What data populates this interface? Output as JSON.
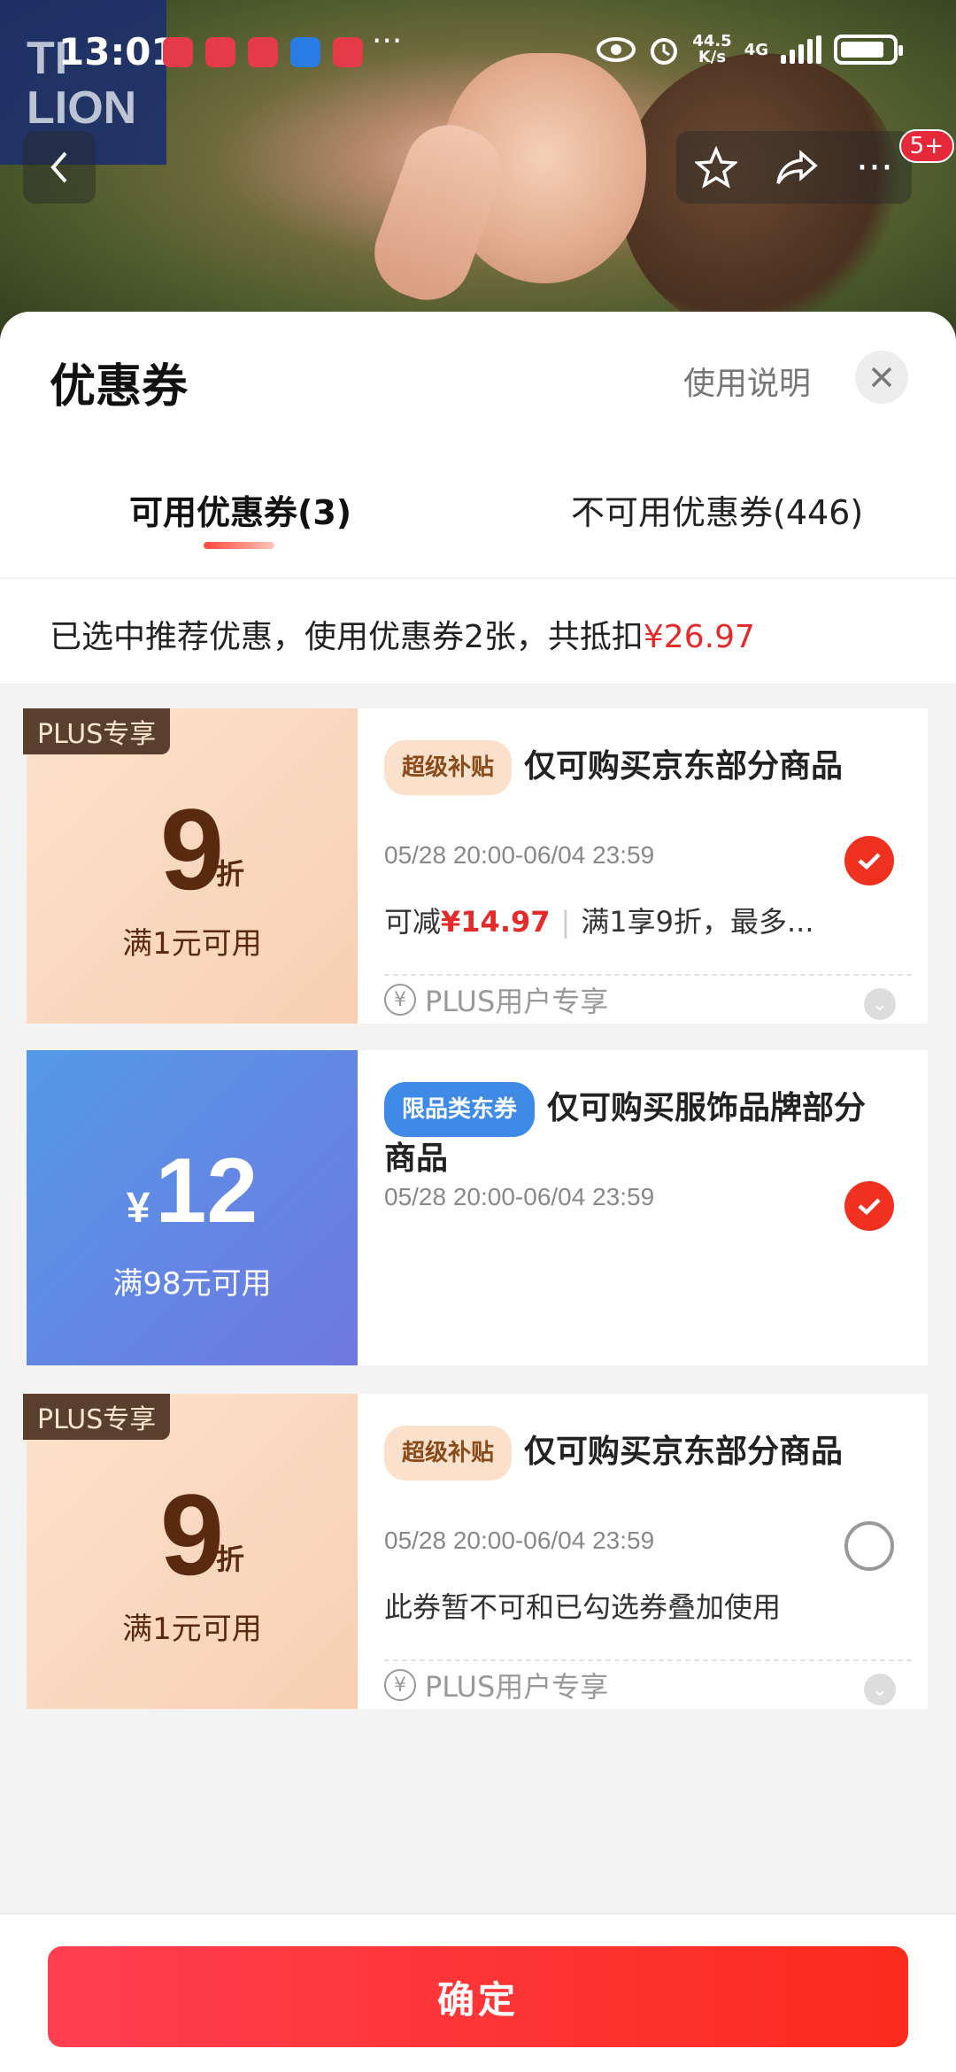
{
  "status_bar": {
    "time": "13:01",
    "more": "···",
    "net_speed_value": "44.5",
    "net_speed_unit": "K/s",
    "network": "4G"
  },
  "header": {
    "logo_line1": "TI",
    "logo_line2": "LION",
    "back_icon": "chevron-left-icon",
    "favorite_icon": "star-icon",
    "share_icon": "share-icon",
    "more_label": "···",
    "badge": "5+"
  },
  "sheet": {
    "title": "优惠券",
    "help_label": "使用说明",
    "close_icon": "close-icon",
    "tabs": [
      {
        "label": "可用优惠券(3)",
        "active": true
      },
      {
        "label": "不可用优惠券(446)",
        "active": false
      }
    ],
    "summary": {
      "text": "已选中推荐优惠，使用优惠券2张，共抵扣",
      "amount": "¥26.97"
    },
    "coupons": [
      {
        "plus_tag": "PLUS专享",
        "value": "9",
        "unit": "折",
        "condition": "满1元可用",
        "tag": "超级补贴",
        "title": "仅可购买京东部分商品",
        "date": "05/28 20:00-06/04 23:59",
        "desc_prefix": "可减",
        "desc_amount": "¥14.97",
        "desc_sep": "|",
        "desc_rest": "满1享9折，最多...",
        "footer": "PLUS用户专享",
        "checked": true
      },
      {
        "currency": "¥",
        "value": "12",
        "condition": "满98元可用",
        "tag": "限品类东券",
        "title": "仅可购买服饰品牌部分商品",
        "date": "05/28 20:00-06/04 23:59",
        "checked": true
      },
      {
        "plus_tag": "PLUS专享",
        "value": "9",
        "unit": "折",
        "condition": "满1元可用",
        "tag": "超级补贴",
        "title": "仅可购买京东部分商品",
        "date": "05/28 20:00-06/04 23:59",
        "desc": "此券暂不可和已勾选券叠加使用",
        "footer": "PLUS用户专享",
        "checked": false
      }
    ],
    "confirm_label": "确定"
  },
  "colors": {
    "accent_red": "#f0311f",
    "amount_red": "#e52a2a",
    "plus_brown": "#5a3e2e"
  }
}
